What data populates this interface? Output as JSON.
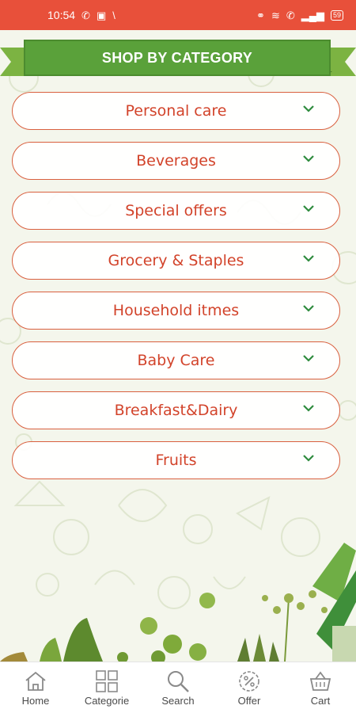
{
  "status_bar": {
    "time": "10:54",
    "battery": "59"
  },
  "banner": {
    "title": "SHOP BY CATEGORY"
  },
  "categories": [
    {
      "label": "Personal care"
    },
    {
      "label": "Beverages"
    },
    {
      "label": "Special offers"
    },
    {
      "label": "Grocery & Staples"
    },
    {
      "label": "Household itmes"
    },
    {
      "label": "Baby Care"
    },
    {
      "label": "Breakfast&Dairy"
    },
    {
      "label": "Fruits"
    }
  ],
  "bottom_nav": {
    "items": [
      {
        "label": "Home",
        "icon": "home-icon"
      },
      {
        "label": "Categorie",
        "icon": "grid-icon"
      },
      {
        "label": "Search",
        "icon": "search-icon"
      },
      {
        "label": "Offer",
        "icon": "percent-badge-icon"
      },
      {
        "label": "Cart",
        "icon": "cart-icon"
      }
    ]
  },
  "colors": {
    "status_bar": "#e8503a",
    "banner": "#5aa13a",
    "category_border": "#d9603f",
    "category_text": "#d2432a",
    "chevron": "#2e8b3d"
  }
}
